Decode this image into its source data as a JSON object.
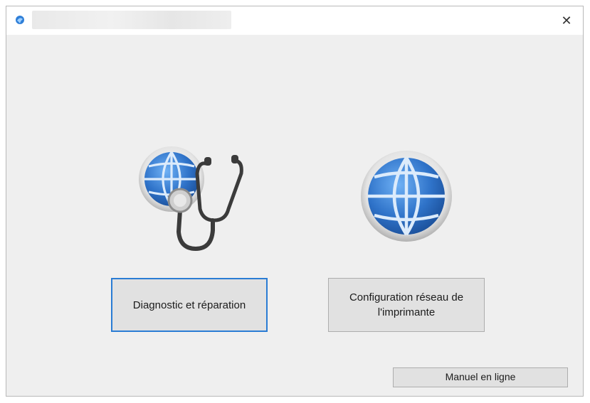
{
  "window": {
    "title": "",
    "close_glyph": "✕"
  },
  "icons": {
    "app": "app-icon",
    "diagnose": "globe-stethoscope-icon",
    "network": "globe-icon"
  },
  "buttons": {
    "diagnose_label": "Diagnostic et réparation",
    "network_label_line1": "Configuration réseau de",
    "network_label_line2": "l'imprimante",
    "manual_label": "Manuel en ligne"
  },
  "colors": {
    "window_bg": "#efefef",
    "titlebar_bg": "#ffffff",
    "focus_border": "#2a7cd4",
    "globe_blue": "#2f73c9"
  }
}
